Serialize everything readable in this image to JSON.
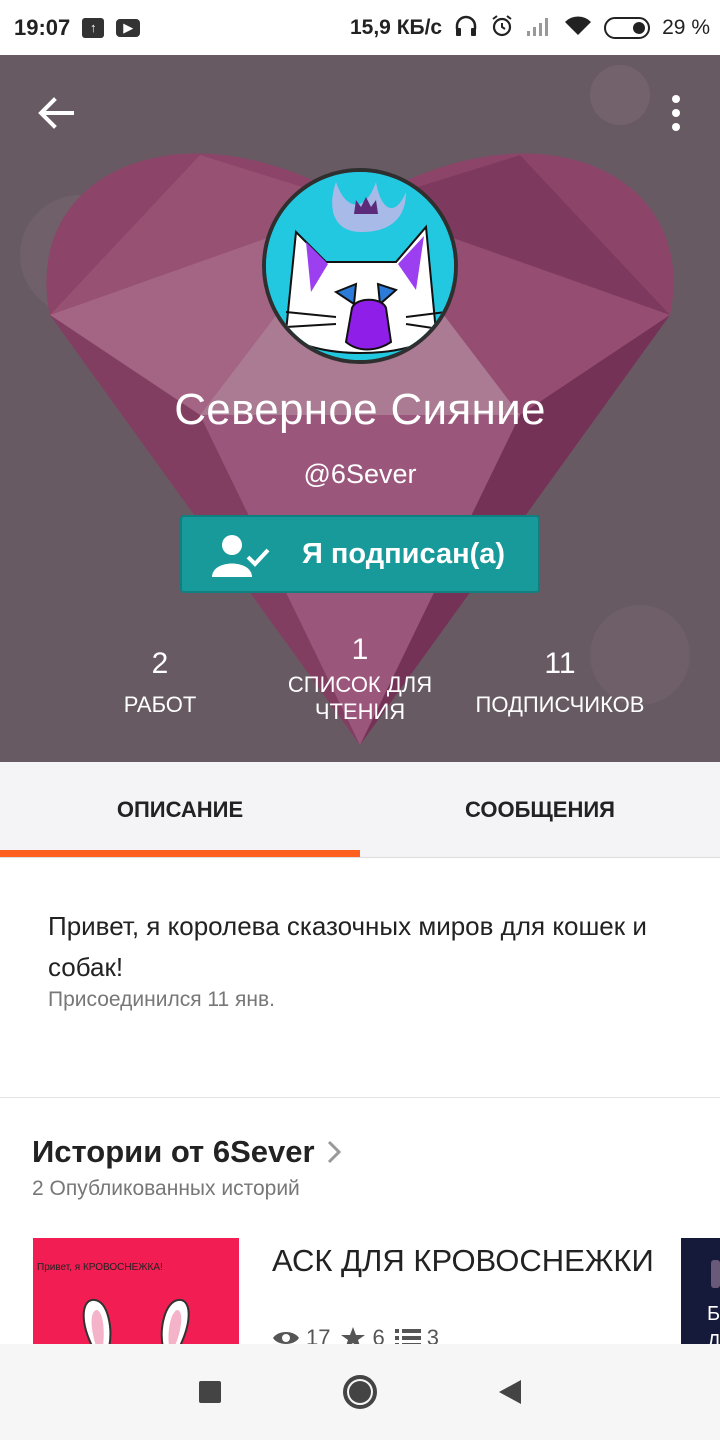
{
  "status_bar": {
    "time": "19:07",
    "speed": "15,9 КБ/с",
    "battery": "29 %",
    "icons": [
      "upload-icon",
      "youtube-icon",
      "headphones-icon",
      "alarm-icon",
      "signal-icon",
      "wifi-icon",
      "battery-icon"
    ]
  },
  "profile": {
    "display_name": "Северное Сияние",
    "username": "@6Sever",
    "follow_label": "Я подписан(а)",
    "stats": {
      "works": {
        "value": "2",
        "label": "РАБОТ"
      },
      "reading_lists": {
        "value": "1",
        "label_line1": "СПИСОК ДЛЯ",
        "label_line2": "ЧТЕНИЯ"
      },
      "followers": {
        "value": "11",
        "label": "ПОДПИСЧИКОВ"
      }
    }
  },
  "tabs": {
    "about": "ОПИСАНИЕ",
    "messages": "СООБЩЕНИЯ"
  },
  "about": {
    "description": "Привет, я королева сказочных миров для кошек и собак!",
    "joined": "Присоединился 11 янв."
  },
  "stories": {
    "title": "Истории от 6Sever",
    "subtitle": "2 Опубликованных историй",
    "items": [
      {
        "title": "АСК ДЛЯ КРОВОСНЕЖКИ",
        "cover_text": "Привет, я КРОВОСНЕЖКА!",
        "reads": "17",
        "votes": "6",
        "parts": "3"
      }
    ],
    "next_cover_text": "Б\nД"
  },
  "colors": {
    "accent_teal": "#18999a",
    "tab_indicator": "#ff5f1f",
    "cover_pink": "#f21d52"
  }
}
